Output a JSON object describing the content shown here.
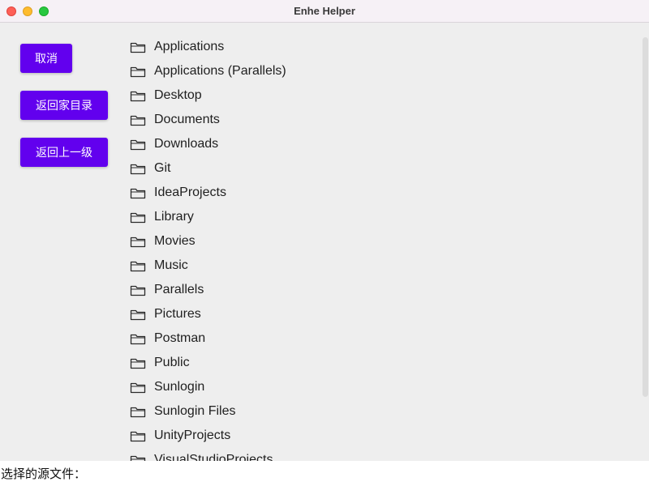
{
  "window": {
    "title": "Enhe Helper"
  },
  "sidebar": {
    "cancel_label": "取消",
    "home_label": "返回家目录",
    "up_label": "返回上一级"
  },
  "list": {
    "icon": "folder-icon",
    "items": [
      "Applications",
      "Applications (Parallels)",
      "Desktop",
      "Documents",
      "Downloads",
      "Git",
      "IdeaProjects",
      "Library",
      "Movies",
      "Music",
      "Parallels",
      "Pictures",
      "Postman",
      "Public",
      "Sunlogin",
      "Sunlogin Files",
      "UnityProjects",
      "VisualStudioProjects"
    ]
  },
  "status": {
    "label": "选择的源文件："
  },
  "colors": {
    "accent": "#6200ee",
    "background": "#eeeeee",
    "titlebar": "#f6f1f6"
  }
}
